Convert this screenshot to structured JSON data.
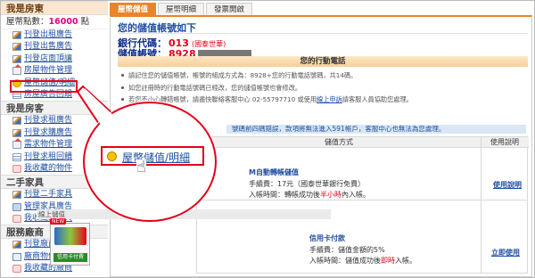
{
  "sidebar": {
    "landlord_title": "我是房東",
    "points_label": "屋幣點數：",
    "points_value": "16000",
    "points_unit": "點",
    "landlord_items": [
      {
        "label": "刊登出租廣告",
        "icon": "pencil-icon"
      },
      {
        "label": "刊登出售廣告",
        "icon": "pencil-icon"
      },
      {
        "label": "刊登店面頂讓",
        "icon": "pencil-icon"
      },
      {
        "label": "房屋物件管理",
        "icon": "house-icon"
      },
      {
        "label": "屋幣儲值/明細",
        "icon": "coin-icon"
      },
      {
        "label": "房屋廣告回饋",
        "icon": "list-icon"
      }
    ],
    "tenant_title": "我是房客",
    "tenant_items": [
      {
        "label": "刊登求租廣告",
        "icon": "pencil-icon"
      },
      {
        "label": "刊登求購廣告",
        "icon": "pencil-icon"
      },
      {
        "label": "需求物件管理",
        "icon": "house-icon"
      },
      {
        "label": "刊登求租回饋",
        "icon": "list-icon"
      },
      {
        "label": "我收藏的物件",
        "icon": "heart-icon"
      }
    ],
    "furniture_title": "二手家具",
    "furniture_items": [
      {
        "label": "刊登二手家具",
        "icon": "pencil-icon"
      },
      {
        "label": "管理家具廣告",
        "icon": "sofa-icon"
      },
      {
        "label": "我收藏的家具",
        "icon": "heart-icon"
      }
    ],
    "vendor_title": "服務廠商",
    "vendor_items": [
      {
        "label": "刊登廠商廣告",
        "icon": "pencil-icon"
      },
      {
        "label": "廠商物件管理",
        "icon": "store-icon"
      },
      {
        "label": "我收藏的廠商",
        "icon": "heart-icon"
      }
    ]
  },
  "tabs": [
    {
      "label": "屋幣儲值",
      "active": true
    },
    {
      "label": "屋幣明細",
      "active": false
    },
    {
      "label": "發票開啟",
      "active": false
    }
  ],
  "account": {
    "heading": "您的儲值帳號如下",
    "bank_label": "銀行代碼：",
    "bank_code": "013",
    "bank_note": "(國泰世華)",
    "acct_label": "儲值帳號：",
    "acct_prefix": "8928"
  },
  "phone_bar": "您的行動電話",
  "notes": [
    "請記住您的儲值帳號，帳號的組成方式為：8928+您的行動電話號碼，共14碼。",
    "如您註冊時的行動電話號碼已經改，您的儲值帳號也會修改。",
    "若您不小心轉錯帳號，請盡快聯絡客服中心 02-55797710 或使用",
    "線上申訴",
    "請客服人員協助您處理。"
  ],
  "blue_note": "號碼前四碼錯誤，款項將無法進入591帳戶，客服中心也無法為您處理。",
  "table": {
    "col_method": "儲值方式",
    "col_help": "使用說明",
    "atm": {
      "title": "M自動轉帳儲值",
      "fee": "手續費：17元（國泰世華銀行免費）",
      "time_prefix": "入帳時間：轉帳成功後",
      "time_hl": "半小時",
      "time_suffix": "內入帳。",
      "help": "使用說明"
    },
    "sub_head": "線上儲值",
    "card": {
      "title": "信用卡付款",
      "fee": "手續費：儲值金額的5%",
      "time_prefix": "入帳時間：儲值成功後",
      "time_hl": "即時",
      "time_suffix": "入帳。",
      "help": "立即使用",
      "badge": "NEW",
      "img_label": "信用卡付費"
    }
  },
  "callout": {
    "label": "屋幣儲值/明細"
  },
  "colors": {
    "accent": "#e8842a",
    "highlight": "#e5001a",
    "link": "#1f4fa0"
  }
}
